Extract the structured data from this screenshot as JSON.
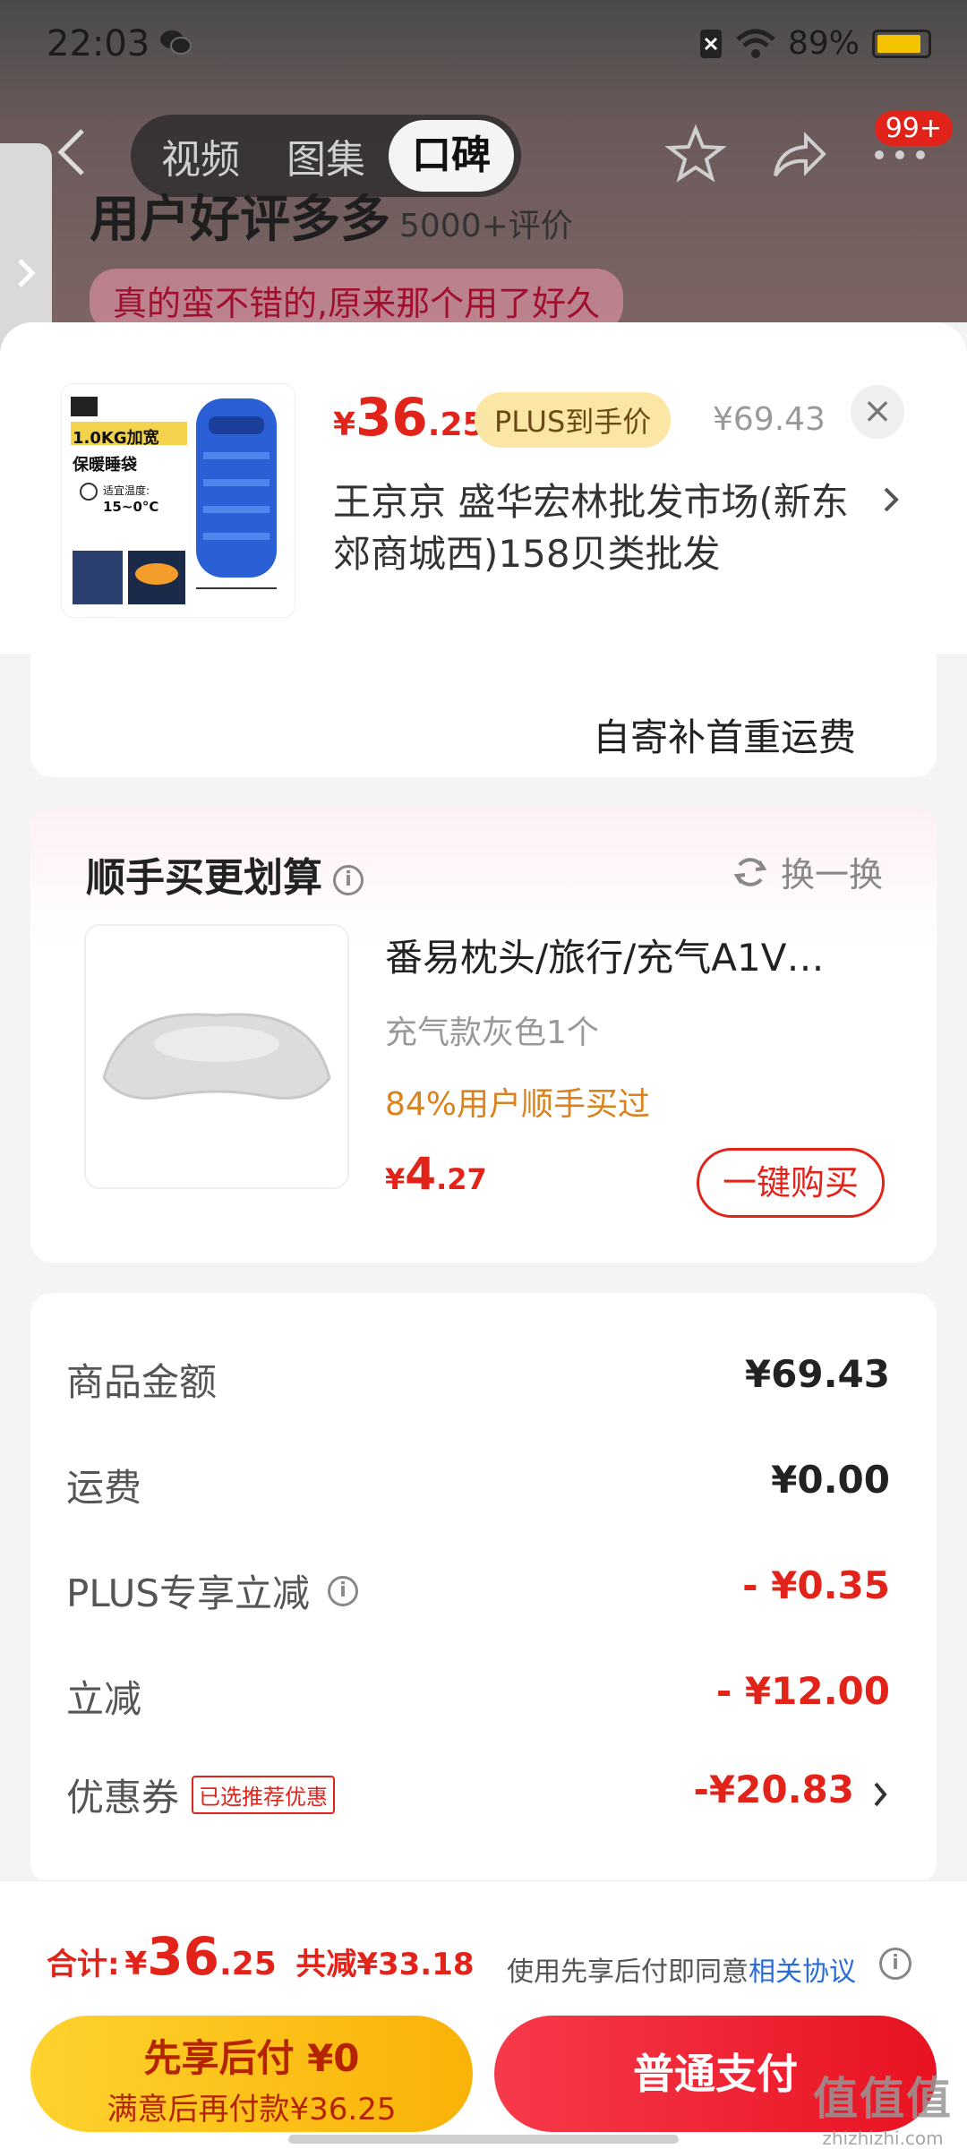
{
  "status_bar": {
    "time": "22:03",
    "battery": "89%",
    "battery_level": 0.89
  },
  "nav": {
    "tabs": [
      {
        "label": "视频"
      },
      {
        "label": "图集"
      },
      {
        "label": "口碑"
      }
    ],
    "badge": "99+"
  },
  "background": {
    "headline": "用户好评多多",
    "review_count": "5000+评价",
    "review_snippet": "真的蛮不错的,原来那个用了好久"
  },
  "product": {
    "price_currency": "¥",
    "price_int": "36",
    "price_dec": ".25",
    "plus_label": "PLUS到手价",
    "orig_price": "¥69.43",
    "close": "×",
    "shop": "王京京  盛华宏林批发市场(新东郊商城西)158贝类批发",
    "image_texts": {
      "line1": "1.0KG加宽",
      "line2": "保暖睡袋",
      "temp_label": "适宜温度:",
      "temp": "15~0°C"
    }
  },
  "shipping": {
    "text": "自寄补首重运费"
  },
  "combo": {
    "title": "顺手买更划算",
    "refresh": "换一换",
    "item": {
      "name": "番易枕头/旅行/充气A1V…",
      "spec": "充气款灰色1个",
      "stat": "84%用户顺手买过",
      "price_currency": "¥",
      "price_int": "4",
      "price_dec": ".27",
      "buy_label": "一键购买"
    }
  },
  "fees": [
    {
      "label": "商品金额",
      "value": "¥69.43",
      "red": false
    },
    {
      "label": "运费",
      "value": "¥0.00",
      "red": false
    },
    {
      "label": "PLUS专享立减",
      "value": "- ¥0.35",
      "red": true
    },
    {
      "label": "立减",
      "value": "- ¥12.00",
      "red": true
    },
    {
      "label": "优惠券",
      "value": "-¥20.83",
      "red": true,
      "tag": "已选推荐优惠"
    }
  ],
  "bottom": {
    "total_label": "合计:",
    "total_currency": "¥",
    "total_int": "36",
    "total_dec": ".25",
    "total_save": "共减¥33.18",
    "agree_text": "使用先享后付即同意",
    "agree_link": "相关协议",
    "pay_later_title": "先享后付 ¥0",
    "pay_later_sub": "满意后再付款¥36.25",
    "pay_normal": "普通支付"
  },
  "watermark": {
    "main": "值值值",
    "sub": "zhizhizhi.com"
  },
  "colors": {
    "accent_red": "#e2231a",
    "plus_gold": "#fbe6a6",
    "pay_later_yellow": "#ffd22e"
  }
}
